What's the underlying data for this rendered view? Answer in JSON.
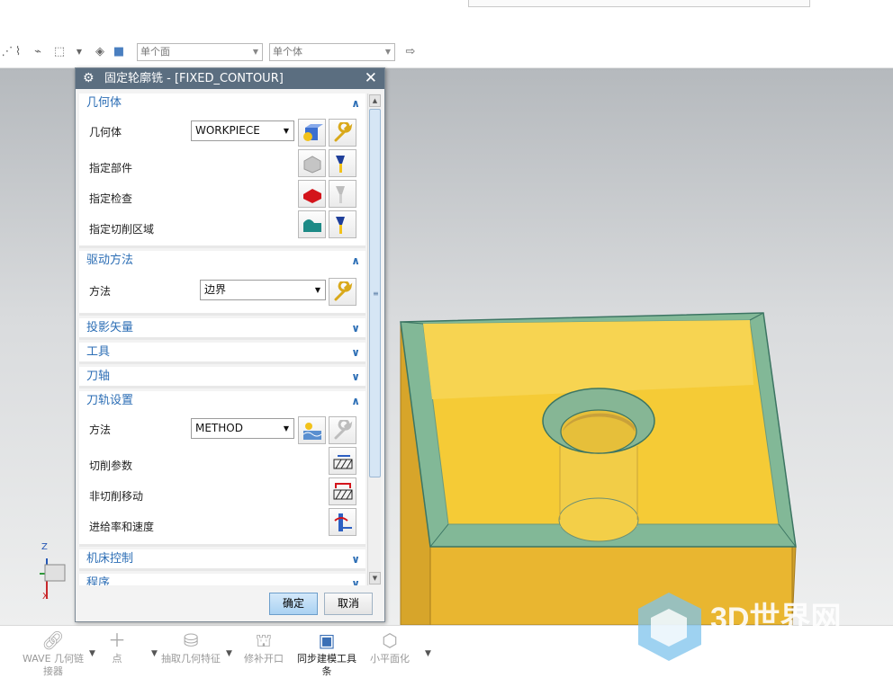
{
  "toolbar": {
    "select_face": "单个面",
    "select_body": "单个体"
  },
  "dialog": {
    "title": "固定轮廓铣 - [FIXED_CONTOUR]",
    "ok_label": "确定",
    "cancel_label": "取消",
    "sections": {
      "geometry": {
        "header": "几何体",
        "geometry_label": "几何体",
        "geometry_value": "WORKPIECE",
        "specify_part": "指定部件",
        "specify_check": "指定检查",
        "specify_cut_area": "指定切削区域"
      },
      "drive": {
        "header": "驱动方法",
        "method_label": "方法",
        "method_value": "边界"
      },
      "projection": {
        "header": "投影矢量"
      },
      "tool": {
        "header": "工具"
      },
      "axis": {
        "header": "刀轴"
      },
      "path_settings": {
        "header": "刀轨设置",
        "method_label": "方法",
        "method_value": "METHOD",
        "cut_params": "切削参数",
        "non_cut_moves": "非切削移动",
        "feeds_speeds": "进给率和速度"
      },
      "machine": {
        "header": "机床控制"
      },
      "program": {
        "header": "程序"
      }
    }
  },
  "bottom_toolbar": [
    {
      "label": "WAVE 几何链接器",
      "icon": "chain-link-icon"
    },
    {
      "label": "点",
      "icon": "point-plus-icon"
    },
    {
      "label": "抽取几何特征",
      "icon": "extract-geometry-icon"
    },
    {
      "label": "修补开口",
      "icon": "patch-opening-icon"
    },
    {
      "label": "同步建模工具条",
      "icon": "synchronous-modeling-icon"
    },
    {
      "label": "小平面化",
      "icon": "facet-icon"
    }
  ],
  "triad": {
    "z": "Z",
    "x": "X"
  },
  "watermark": "3D世界网",
  "colors": {
    "title_bar": "#5b6e80",
    "section_header": "#2c6eb5",
    "part_yellow": "#f5c93a",
    "part_wall_green": "#7fb89a",
    "ok_button": "#a9d1f2"
  }
}
